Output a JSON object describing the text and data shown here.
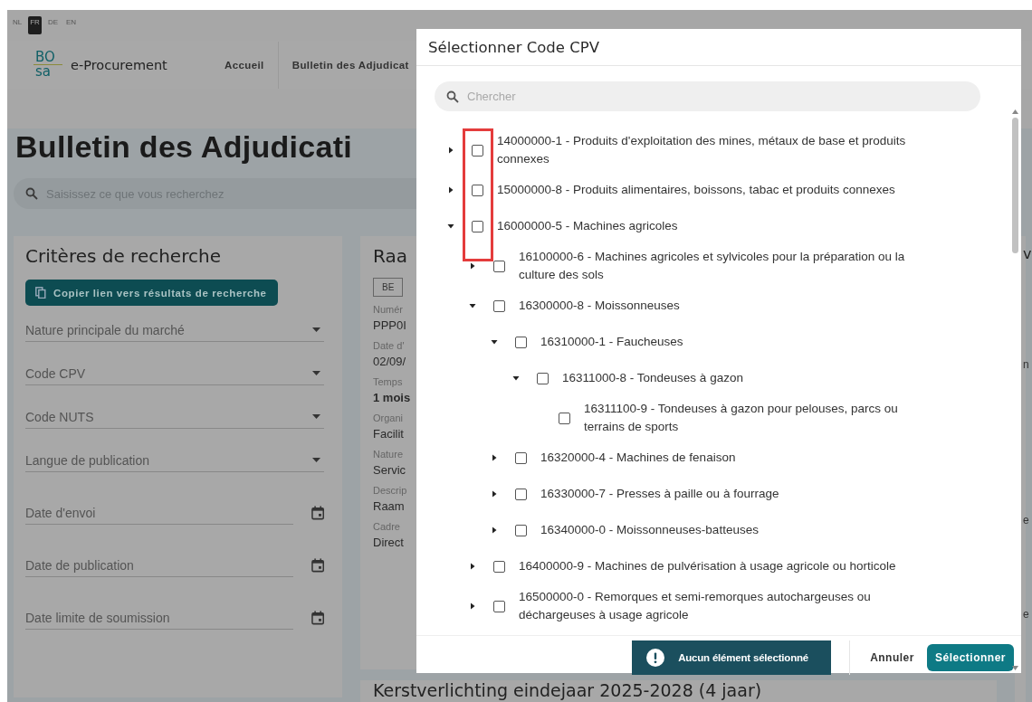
{
  "languages": [
    {
      "label": "NL",
      "selected": false
    },
    {
      "label": "FR",
      "selected": true
    },
    {
      "label": "DE",
      "selected": false
    },
    {
      "label": "EN",
      "selected": false
    }
  ],
  "logo": [
    "BO",
    "sa"
  ],
  "app_name": "e-Procurement",
  "nav": [
    "Accueil",
    "Bulletin des Adjudicat"
  ],
  "page_title": "Bulletin des Adjudicati",
  "search": {
    "placeholder": "Saisissez ce que vous recherchez"
  },
  "criteria": {
    "title": "Critères de recherche",
    "copy_button": "Copier lien vers résultats de recherche",
    "fields": [
      {
        "kind": "select",
        "placeholder": "Nature principale du marché"
      },
      {
        "kind": "select",
        "placeholder": "Code CPV"
      },
      {
        "kind": "select",
        "placeholder": "Code NUTS"
      },
      {
        "kind": "select",
        "placeholder": "Langue de publication"
      },
      {
        "kind": "date",
        "placeholder": "Date d'envoi"
      },
      {
        "kind": "date",
        "placeholder": "Date de publication"
      },
      {
        "kind": "date",
        "placeholder": "Date limite de soumission"
      }
    ]
  },
  "result_card": {
    "title": "Raa",
    "tag": "BE",
    "fields": [
      {
        "label": "Numér",
        "value": "PPP0I",
        "bold": false
      },
      {
        "label": "Date d'",
        "value": "02/09/",
        "bold": false
      },
      {
        "label": "Temps",
        "value": "1 mois",
        "bold": true
      },
      {
        "label": "Organi",
        "value": "Facilit",
        "bold": false
      },
      {
        "label": "Nature",
        "value": "Servic",
        "bold": false
      },
      {
        "label": "Descrip",
        "value": "Raam",
        "bold": false
      },
      {
        "label": "Cadre",
        "value": "Direct",
        "bold": false
      }
    ]
  },
  "next_card": {
    "title": "Kerstverlichting eindejaar 2025-2028 (4 jaar)"
  },
  "right_card": {
    "title": "v",
    "fragments": [
      "n",
      "e",
      "e"
    ]
  },
  "dialog": {
    "title": "Sélectionner Code CPV",
    "search": {
      "placeholder": "Chercher"
    },
    "tree": [
      {
        "label": "14000000-1 - Produits d'exploitation des mines, métaux de base et produits connexes",
        "expandable": true,
        "expanded": false,
        "checked": false
      },
      {
        "label": "15000000-8 - Produits alimentaires, boissons, tabac et produits connexes",
        "expandable": true,
        "expanded": false,
        "checked": false
      },
      {
        "label": "16000000-5 - Machines agricoles",
        "expandable": true,
        "expanded": true,
        "checked": false,
        "children": [
          {
            "label": "16100000-6 - Machines agricoles et sylvicoles pour la préparation ou la culture des sols",
            "expandable": true,
            "expanded": false,
            "checked": false
          },
          {
            "label": "16300000-8 - Moissonneuses",
            "expandable": true,
            "expanded": true,
            "checked": false,
            "children": [
              {
                "label": "16310000-1 - Faucheuses",
                "expandable": true,
                "expanded": true,
                "checked": false,
                "children": [
                  {
                    "label": "16311000-8 - Tondeuses à gazon",
                    "expandable": true,
                    "expanded": true,
                    "checked": false,
                    "children": [
                      {
                        "label": "16311100-9 - Tondeuses à gazon pour pelouses, parcs ou terrains de sports",
                        "expandable": false,
                        "checked": false
                      }
                    ]
                  }
                ]
              },
              {
                "label": "16320000-4 - Machines de fenaison",
                "expandable": true,
                "expanded": false,
                "checked": false
              },
              {
                "label": "16330000-7 - Presses à paille ou à fourrage",
                "expandable": true,
                "expanded": false,
                "checked": false
              },
              {
                "label": "16340000-0 - Moissonneuses-batteuses",
                "expandable": true,
                "expanded": false,
                "checked": false
              }
            ]
          },
          {
            "label": "16400000-9 - Machines de pulvérisation à usage agricole ou horticole",
            "expandable": true,
            "expanded": false,
            "checked": false
          },
          {
            "label": "16500000-0 - Remorques et semi-remorques autochargeuses ou déchargeuses à usage agricole",
            "expandable": true,
            "expanded": false,
            "checked": false
          }
        ]
      }
    ],
    "status": "Aucun élément sélectionné",
    "buttons": [
      {
        "label": "Annuler",
        "kind": "text"
      },
      {
        "label": "Sélectionner",
        "kind": "primary"
      }
    ]
  }
}
